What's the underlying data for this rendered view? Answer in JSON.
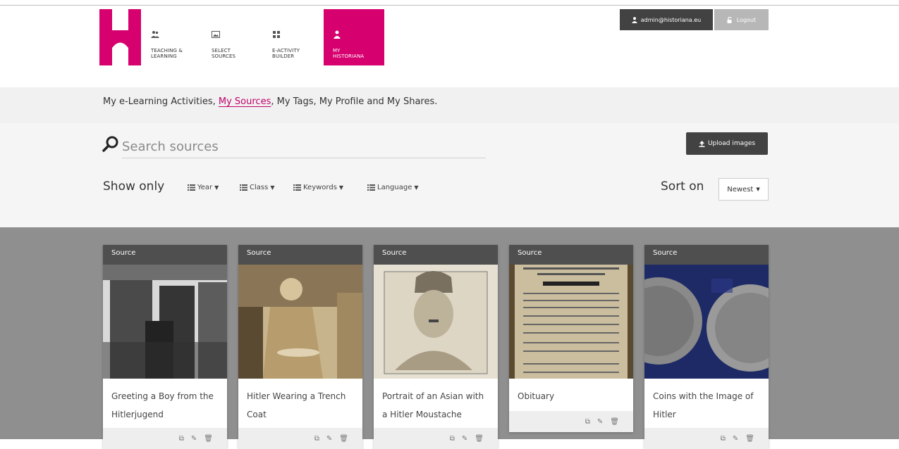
{
  "header": {
    "nav": [
      {
        "label": "TEACHING &\nLEARNING",
        "icon": "users-icon"
      },
      {
        "label": "SELECT\nSOURCES",
        "icon": "image-icon"
      },
      {
        "label": "E-ACTIVITY\nBUILDER",
        "icon": "grid-icon"
      },
      {
        "label": "MY\nHISTORIANA",
        "icon": "user-icon",
        "active": true
      }
    ],
    "user_button": "admin@historiana.eu",
    "logout_button": "Logout"
  },
  "subnav": {
    "links": [
      "My e-Learning Activities,",
      "My Sources",
      ",",
      "My Tags,",
      "My Profile and My Shares."
    ]
  },
  "filters": {
    "search_placeholder": "Search sources",
    "upload_button": "Upload images",
    "show_only": "Show only",
    "filter_year": "Year",
    "filter_class": "Class",
    "filter_keywords": "Keywords",
    "filter_language": "Language",
    "sort_on": "Sort on",
    "sort_value": "Newest"
  },
  "cards": [
    {
      "tag": "Source",
      "title": "Greeting a Boy from the Hitlerjugend"
    },
    {
      "tag": "Source",
      "title": "Hitler Wearing a Trench Coat"
    },
    {
      "tag": "Source",
      "title": "Portrait of an Asian with a Hitler Moustache"
    },
    {
      "tag": "Source",
      "title": "Obituary"
    },
    {
      "tag": "Source",
      "title": "Coins with the Image of Hitler"
    }
  ],
  "colors": {
    "brand": "#d6006f",
    "dark": "#424242",
    "grid_bg": "#8f8f8f"
  }
}
